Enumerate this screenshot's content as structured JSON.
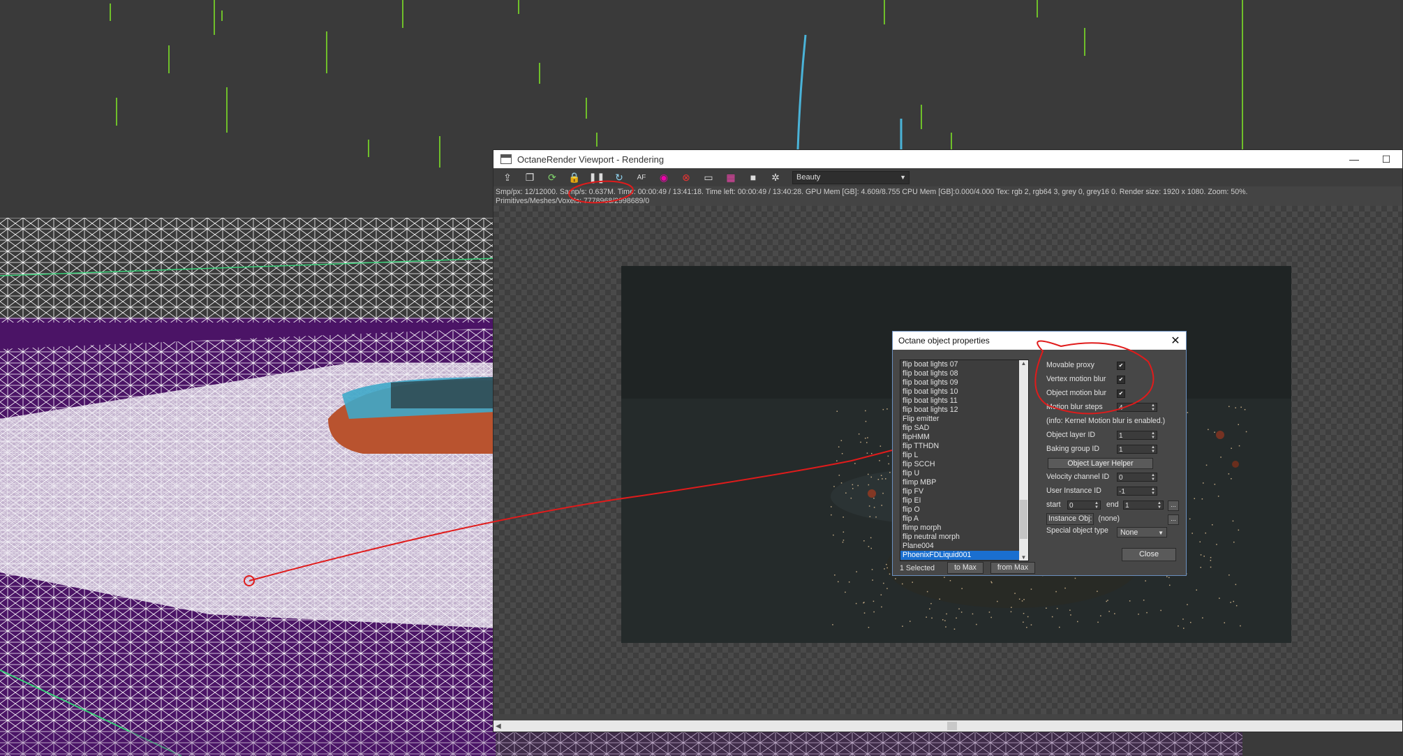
{
  "viewport_window": {
    "title": "OctaneRender Viewport - Rendering",
    "window_buttons": {
      "minimize": "—",
      "maximize": "☐"
    },
    "toolbar_icons": [
      "send-scene-icon",
      "copy-icon",
      "restart-render-icon",
      "lock-icon",
      "pause-icon",
      "refresh-icon",
      "af-icon",
      "color-wheel-icon",
      "region-icon",
      "monitor-icon",
      "film-icon",
      "camera-icon",
      "settings-icon"
    ],
    "render_pass": "Beauty",
    "stats_line1": "Smp/px: 12/12000.   Samp/s: 0.637M.   Time: 00:00:49 / 13:41:18.   Time left: 00:00:49 / 13:40:28.   GPU Mem [GB]: 4.609/8.755   CPU Mem [GB]:0.000/4.000   Tex: rgb 2, rgb64 3, grey 0, grey16 0.   Render size: 1920 x 1080.   Zoom: 50%.",
    "stats_line2": "Primitives/Meshes/Voxels: 7778968/2998689/0"
  },
  "dialog": {
    "title": "Octane object properties",
    "close_glyph": "✕",
    "objects": [
      "flip boat lights 07",
      "flip boat lights 08",
      "flip boat lights 09",
      "flip boat lights 10",
      "flip boat lights 11",
      "flip boat lights 12",
      "Flip emitter",
      "flip SAD",
      "flipHMM",
      "flip TTHDN",
      "flip L",
      "flip SCCH",
      "flip U",
      "flimp MBP",
      "flip FV",
      "flip EI",
      "flip O",
      "flip  A",
      "flimp morph",
      "flip neutral morph",
      "Plane004",
      "PhoenixFDLiquid001"
    ],
    "selected_object": "PhoenixFDLiquid001",
    "selected_count": "1 Selected",
    "to_max": "to Max",
    "from_max": "from Max",
    "props": {
      "movable_proxy": "Movable proxy",
      "vertex_motion_blur": "Vertex motion blur",
      "object_motion_blur": "Object motion blur",
      "check": "✔",
      "motion_blur_steps_label": "Motion blur steps",
      "motion_blur_steps": "4",
      "info": "(info: Kernel Motion blur is enabled.)",
      "object_layer_id_label": "Object layer ID",
      "object_layer_id": "1",
      "baking_group_id_label": "Baking group ID",
      "baking_group_id": "1",
      "object_layer_helper": "Object Layer Helper",
      "velocity_channel_id_label": "Velocity channel ID",
      "velocity_channel_id": "0",
      "user_instance_id_label": "User Instance ID",
      "user_instance_id": "-1",
      "start_label": "start",
      "start": "0",
      "end_label": "end",
      "end": "1",
      "ellipsis": "...",
      "instance_obj_label": "Instance Obj:",
      "instance_obj": "(none)",
      "special_object_type_label": "Special object type",
      "special_object_type": "None",
      "close": "Close"
    }
  },
  "colors": {
    "annotation_red": "#e01b1b",
    "wire_white": "#ffffff",
    "purple": "#4b1466",
    "green": "#6fbf2a",
    "cyan": "#4ab3d8"
  }
}
